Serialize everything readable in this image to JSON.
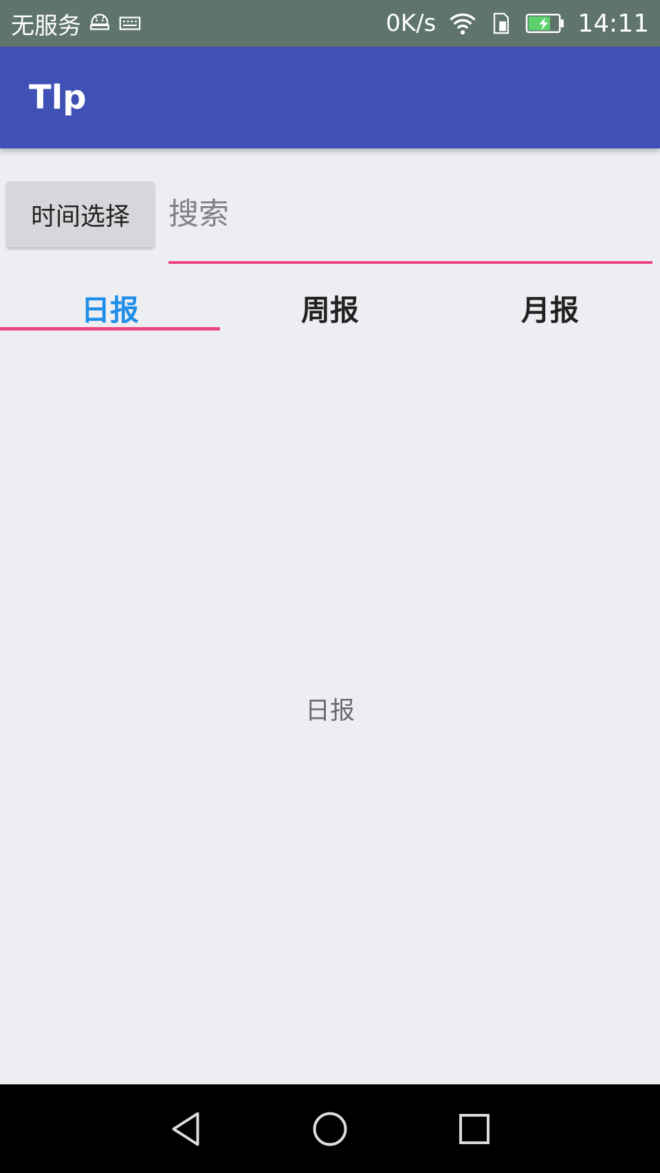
{
  "status_bar": {
    "carrier": "无服务",
    "net_speed": "0K/s",
    "time": "14:11",
    "icons": [
      "android-debug-icon",
      "keyboard-icon",
      "wifi-icon",
      "sim-icon",
      "battery-charging-icon"
    ]
  },
  "app_bar": {
    "title": "Tlp"
  },
  "toolbar": {
    "time_button_label": "时间选择",
    "search_placeholder": "搜索",
    "search_value": ""
  },
  "tabs": [
    {
      "label": "日报",
      "active": true
    },
    {
      "label": "周报",
      "active": false
    },
    {
      "label": "月报",
      "active": false
    }
  ],
  "content": {
    "label": "日报"
  },
  "colors": {
    "status_bar": "#5f756b",
    "app_bar": "#3f51b5",
    "accent": "#ee4783",
    "active_tab": "#1e8ee8",
    "background": "#edeef2"
  }
}
